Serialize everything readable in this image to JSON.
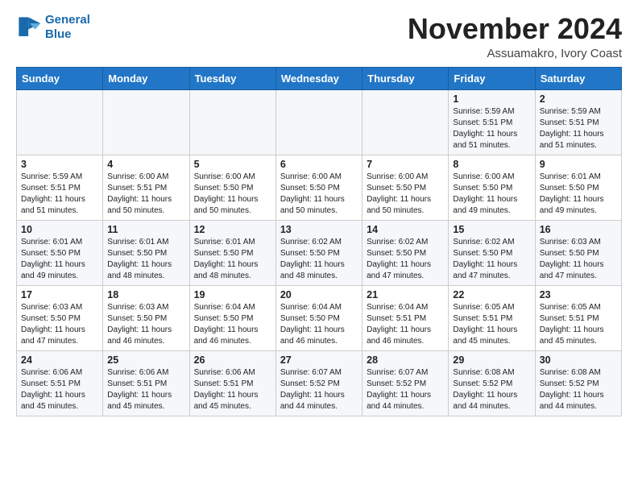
{
  "header": {
    "logo_line1": "General",
    "logo_line2": "Blue",
    "month": "November 2024",
    "location": "Assuamakro, Ivory Coast"
  },
  "weekdays": [
    "Sunday",
    "Monday",
    "Tuesday",
    "Wednesday",
    "Thursday",
    "Friday",
    "Saturday"
  ],
  "weeks": [
    [
      {
        "day": "",
        "info": ""
      },
      {
        "day": "",
        "info": ""
      },
      {
        "day": "",
        "info": ""
      },
      {
        "day": "",
        "info": ""
      },
      {
        "day": "",
        "info": ""
      },
      {
        "day": "1",
        "info": "Sunrise: 5:59 AM\nSunset: 5:51 PM\nDaylight: 11 hours\nand 51 minutes."
      },
      {
        "day": "2",
        "info": "Sunrise: 5:59 AM\nSunset: 5:51 PM\nDaylight: 11 hours\nand 51 minutes."
      }
    ],
    [
      {
        "day": "3",
        "info": "Sunrise: 5:59 AM\nSunset: 5:51 PM\nDaylight: 11 hours\nand 51 minutes."
      },
      {
        "day": "4",
        "info": "Sunrise: 6:00 AM\nSunset: 5:51 PM\nDaylight: 11 hours\nand 50 minutes."
      },
      {
        "day": "5",
        "info": "Sunrise: 6:00 AM\nSunset: 5:50 PM\nDaylight: 11 hours\nand 50 minutes."
      },
      {
        "day": "6",
        "info": "Sunrise: 6:00 AM\nSunset: 5:50 PM\nDaylight: 11 hours\nand 50 minutes."
      },
      {
        "day": "7",
        "info": "Sunrise: 6:00 AM\nSunset: 5:50 PM\nDaylight: 11 hours\nand 50 minutes."
      },
      {
        "day": "8",
        "info": "Sunrise: 6:00 AM\nSunset: 5:50 PM\nDaylight: 11 hours\nand 49 minutes."
      },
      {
        "day": "9",
        "info": "Sunrise: 6:01 AM\nSunset: 5:50 PM\nDaylight: 11 hours\nand 49 minutes."
      }
    ],
    [
      {
        "day": "10",
        "info": "Sunrise: 6:01 AM\nSunset: 5:50 PM\nDaylight: 11 hours\nand 49 minutes."
      },
      {
        "day": "11",
        "info": "Sunrise: 6:01 AM\nSunset: 5:50 PM\nDaylight: 11 hours\nand 48 minutes."
      },
      {
        "day": "12",
        "info": "Sunrise: 6:01 AM\nSunset: 5:50 PM\nDaylight: 11 hours\nand 48 minutes."
      },
      {
        "day": "13",
        "info": "Sunrise: 6:02 AM\nSunset: 5:50 PM\nDaylight: 11 hours\nand 48 minutes."
      },
      {
        "day": "14",
        "info": "Sunrise: 6:02 AM\nSunset: 5:50 PM\nDaylight: 11 hours\nand 47 minutes."
      },
      {
        "day": "15",
        "info": "Sunrise: 6:02 AM\nSunset: 5:50 PM\nDaylight: 11 hours\nand 47 minutes."
      },
      {
        "day": "16",
        "info": "Sunrise: 6:03 AM\nSunset: 5:50 PM\nDaylight: 11 hours\nand 47 minutes."
      }
    ],
    [
      {
        "day": "17",
        "info": "Sunrise: 6:03 AM\nSunset: 5:50 PM\nDaylight: 11 hours\nand 47 minutes."
      },
      {
        "day": "18",
        "info": "Sunrise: 6:03 AM\nSunset: 5:50 PM\nDaylight: 11 hours\nand 46 minutes."
      },
      {
        "day": "19",
        "info": "Sunrise: 6:04 AM\nSunset: 5:50 PM\nDaylight: 11 hours\nand 46 minutes."
      },
      {
        "day": "20",
        "info": "Sunrise: 6:04 AM\nSunset: 5:50 PM\nDaylight: 11 hours\nand 46 minutes."
      },
      {
        "day": "21",
        "info": "Sunrise: 6:04 AM\nSunset: 5:51 PM\nDaylight: 11 hours\nand 46 minutes."
      },
      {
        "day": "22",
        "info": "Sunrise: 6:05 AM\nSunset: 5:51 PM\nDaylight: 11 hours\nand 45 minutes."
      },
      {
        "day": "23",
        "info": "Sunrise: 6:05 AM\nSunset: 5:51 PM\nDaylight: 11 hours\nand 45 minutes."
      }
    ],
    [
      {
        "day": "24",
        "info": "Sunrise: 6:06 AM\nSunset: 5:51 PM\nDaylight: 11 hours\nand 45 minutes."
      },
      {
        "day": "25",
        "info": "Sunrise: 6:06 AM\nSunset: 5:51 PM\nDaylight: 11 hours\nand 45 minutes."
      },
      {
        "day": "26",
        "info": "Sunrise: 6:06 AM\nSunset: 5:51 PM\nDaylight: 11 hours\nand 45 minutes."
      },
      {
        "day": "27",
        "info": "Sunrise: 6:07 AM\nSunset: 5:52 PM\nDaylight: 11 hours\nand 44 minutes."
      },
      {
        "day": "28",
        "info": "Sunrise: 6:07 AM\nSunset: 5:52 PM\nDaylight: 11 hours\nand 44 minutes."
      },
      {
        "day": "29",
        "info": "Sunrise: 6:08 AM\nSunset: 5:52 PM\nDaylight: 11 hours\nand 44 minutes."
      },
      {
        "day": "30",
        "info": "Sunrise: 6:08 AM\nSunset: 5:52 PM\nDaylight: 11 hours\nand 44 minutes."
      }
    ]
  ]
}
